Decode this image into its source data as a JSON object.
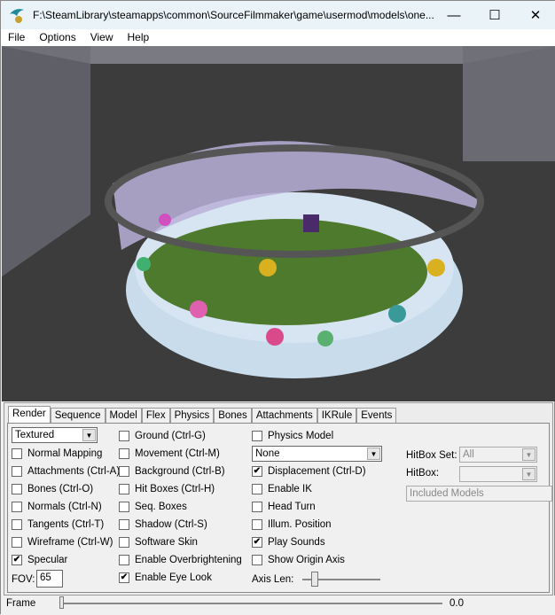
{
  "window": {
    "title": "F:\\SteamLibrary\\steamapps\\common\\SourceFilmmaker\\game\\usermod\\models\\one...",
    "minimize": "—",
    "maximize": "☐",
    "close": "✕"
  },
  "menu": [
    "File",
    "Options",
    "View",
    "Help"
  ],
  "tabs": [
    "Render",
    "Sequence",
    "Model",
    "Flex",
    "Physics",
    "Bones",
    "Attachments",
    "IKRule",
    "Events"
  ],
  "active_tab": "Render",
  "render": {
    "mode_select": "Textured",
    "col1": [
      {
        "label": "Normal Mapping",
        "checked": false
      },
      {
        "label": "Attachments (Ctrl-A)",
        "checked": false
      },
      {
        "label": "Bones (Ctrl-O)",
        "checked": false
      },
      {
        "label": "Normals (Ctrl-N)",
        "checked": false
      },
      {
        "label": "Tangents (Ctrl-T)",
        "checked": false
      },
      {
        "label": "Wireframe (Ctrl-W)",
        "checked": false
      },
      {
        "label": "Specular",
        "checked": true
      }
    ],
    "fov_label": "FOV:",
    "fov_value": "65",
    "col2": [
      {
        "label": "Ground (Ctrl-G)",
        "checked": false
      },
      {
        "label": "Movement (Ctrl-M)",
        "checked": false
      },
      {
        "label": "Background (Ctrl-B)",
        "checked": false
      },
      {
        "label": "Hit Boxes (Ctrl-H)",
        "checked": false
      },
      {
        "label": "Seq. Boxes",
        "checked": false
      },
      {
        "label": "Shadow (Ctrl-S)",
        "checked": false
      },
      {
        "label": "Software Skin",
        "checked": false
      },
      {
        "label": "Enable Overbrightening",
        "checked": false
      },
      {
        "label": "Enable Eye Look",
        "checked": true
      }
    ],
    "physics_model": {
      "label": "Physics Model",
      "checked": false
    },
    "physics_select": "None",
    "col3": [
      {
        "label": "Displacement (Ctrl-D)",
        "checked": true
      },
      {
        "label": "Enable IK",
        "checked": false
      },
      {
        "label": "Head Turn",
        "checked": false
      },
      {
        "label": "Illum. Position",
        "checked": false
      },
      {
        "label": "Play Sounds",
        "checked": true
      },
      {
        "label": "Show Origin Axis",
        "checked": false
      }
    ],
    "axis_len_label": "Axis Len:",
    "hitbox_set_label": "HitBox Set:",
    "hitbox_set_value": "All",
    "hitbox_label": "HitBox:",
    "hitbox_value": "",
    "included_models": "Included Models"
  },
  "frame": {
    "label": "Frame",
    "value": "0.0"
  }
}
